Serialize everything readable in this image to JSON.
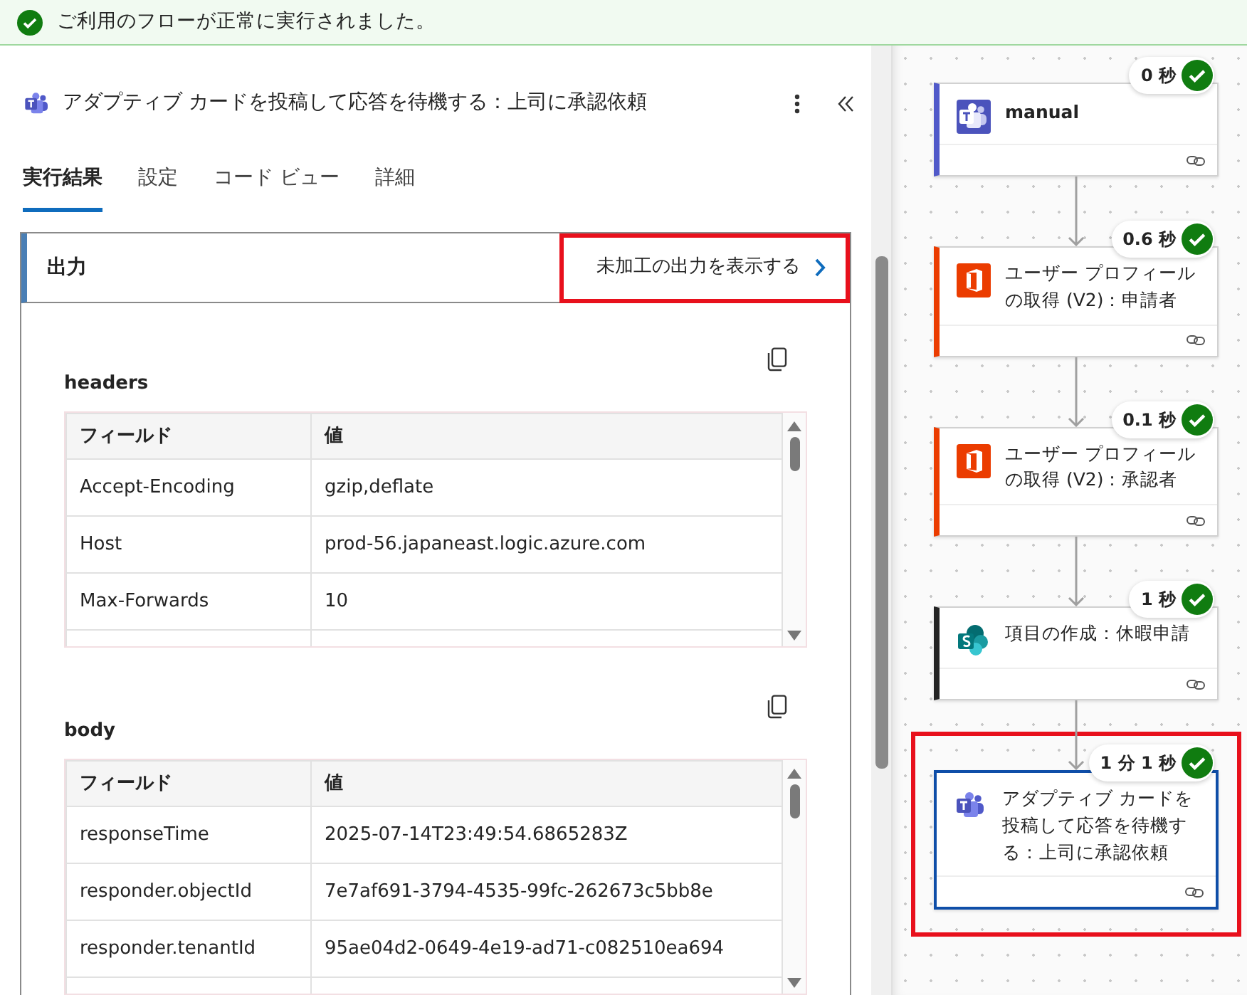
{
  "banner": {
    "text": "ご利用のフローが正常に実行されました。"
  },
  "panel": {
    "title": "アダプティブ カードを投稿して応答を待機する：上司に承認依頼"
  },
  "tabs": [
    {
      "label": "実行結果",
      "selected": true
    },
    {
      "label": "設定",
      "selected": false
    },
    {
      "label": "コード ビュー",
      "selected": false
    },
    {
      "label": "詳細",
      "selected": false
    }
  ],
  "output": {
    "title": "出力",
    "raw_link": {
      "label": "未加工の出力を表示する",
      "highlighted": true
    },
    "sections": [
      {
        "name": "headers",
        "columns": [
          "フィールド",
          "値"
        ],
        "rows": [
          [
            "Accept-Encoding",
            "gzip,deflate"
          ],
          [
            "Host",
            "prod-56.japaneast.logic.azure.com"
          ],
          [
            "Max-Forwards",
            "10"
          ]
        ]
      },
      {
        "name": "body",
        "columns": [
          "フィールド",
          "値"
        ],
        "rows": [
          [
            "responseTime",
            "2025-07-14T23:49:54.6865283Z"
          ],
          [
            "responder.objectId",
            "7e7af691-3794-4535-99fc-262673c5bb8e"
          ],
          [
            "responder.tenantId",
            "95ae04d2-0649-4e19-ad71-c082510ea694"
          ]
        ]
      }
    ]
  },
  "flow": [
    {
      "kind": "teams_trigger",
      "title": "manual",
      "duration": "0 秒",
      "color": "#5059c9",
      "selected": false,
      "highlighted": false
    },
    {
      "kind": "office",
      "title": "ユーザー プロフィールの取得 (V2)：申請者",
      "duration": "0.6 秒",
      "color": "#eb3c00",
      "selected": false,
      "highlighted": false
    },
    {
      "kind": "office",
      "title": "ユーザー プロフィールの取得 (V2)：承認者",
      "duration": "0.1 秒",
      "color": "#eb3c00",
      "selected": false,
      "highlighted": false
    },
    {
      "kind": "sharepoint",
      "title": "項目の作成：休暇申請",
      "duration": "1 秒",
      "color": "#242424",
      "selected": false,
      "highlighted": false
    },
    {
      "kind": "teams",
      "title": "アダプティブ カードを投稿して応答を待機する：上司に承認依頼",
      "duration": "1 分 1 秒",
      "color": "#0f4ea8",
      "selected": true,
      "highlighted": true
    }
  ]
}
